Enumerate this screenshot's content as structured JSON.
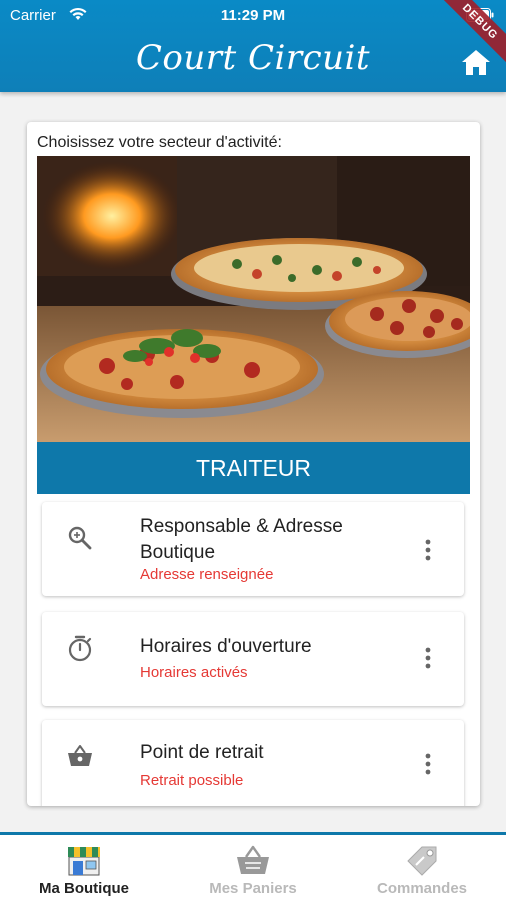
{
  "status_bar": {
    "carrier": "Carrier",
    "time": "11:29 PM"
  },
  "header": {
    "title": "Court Circuit",
    "home_icon": "home-icon",
    "debug_banner": "DEBUG",
    "background_color": "#0a8ac6"
  },
  "card": {
    "prompt": "Choisissez votre secteur d'activité:",
    "hero_image": "pizza-photo",
    "category_label": "TRAITEUR",
    "category_color": "#0e78aa",
    "options": [
      {
        "icon": "search-icon",
        "title": "Responsable & Adresse Boutique",
        "status": "Adresse renseignée"
      },
      {
        "icon": "timer-icon",
        "title": "Horaires d'ouverture",
        "status": "Horaires activés"
      },
      {
        "icon": "basket-icon",
        "title": "Point de retrait",
        "status": "Retrait possible"
      }
    ],
    "status_color": "#e53935"
  },
  "bottom_nav": {
    "items": [
      {
        "label": "Ma Boutique",
        "icon": "shop-icon",
        "active": true
      },
      {
        "label": "Mes Paniers",
        "icon": "basket-icon",
        "active": false
      },
      {
        "label": "Commandes",
        "icon": "tag-icon",
        "active": false
      }
    ]
  }
}
